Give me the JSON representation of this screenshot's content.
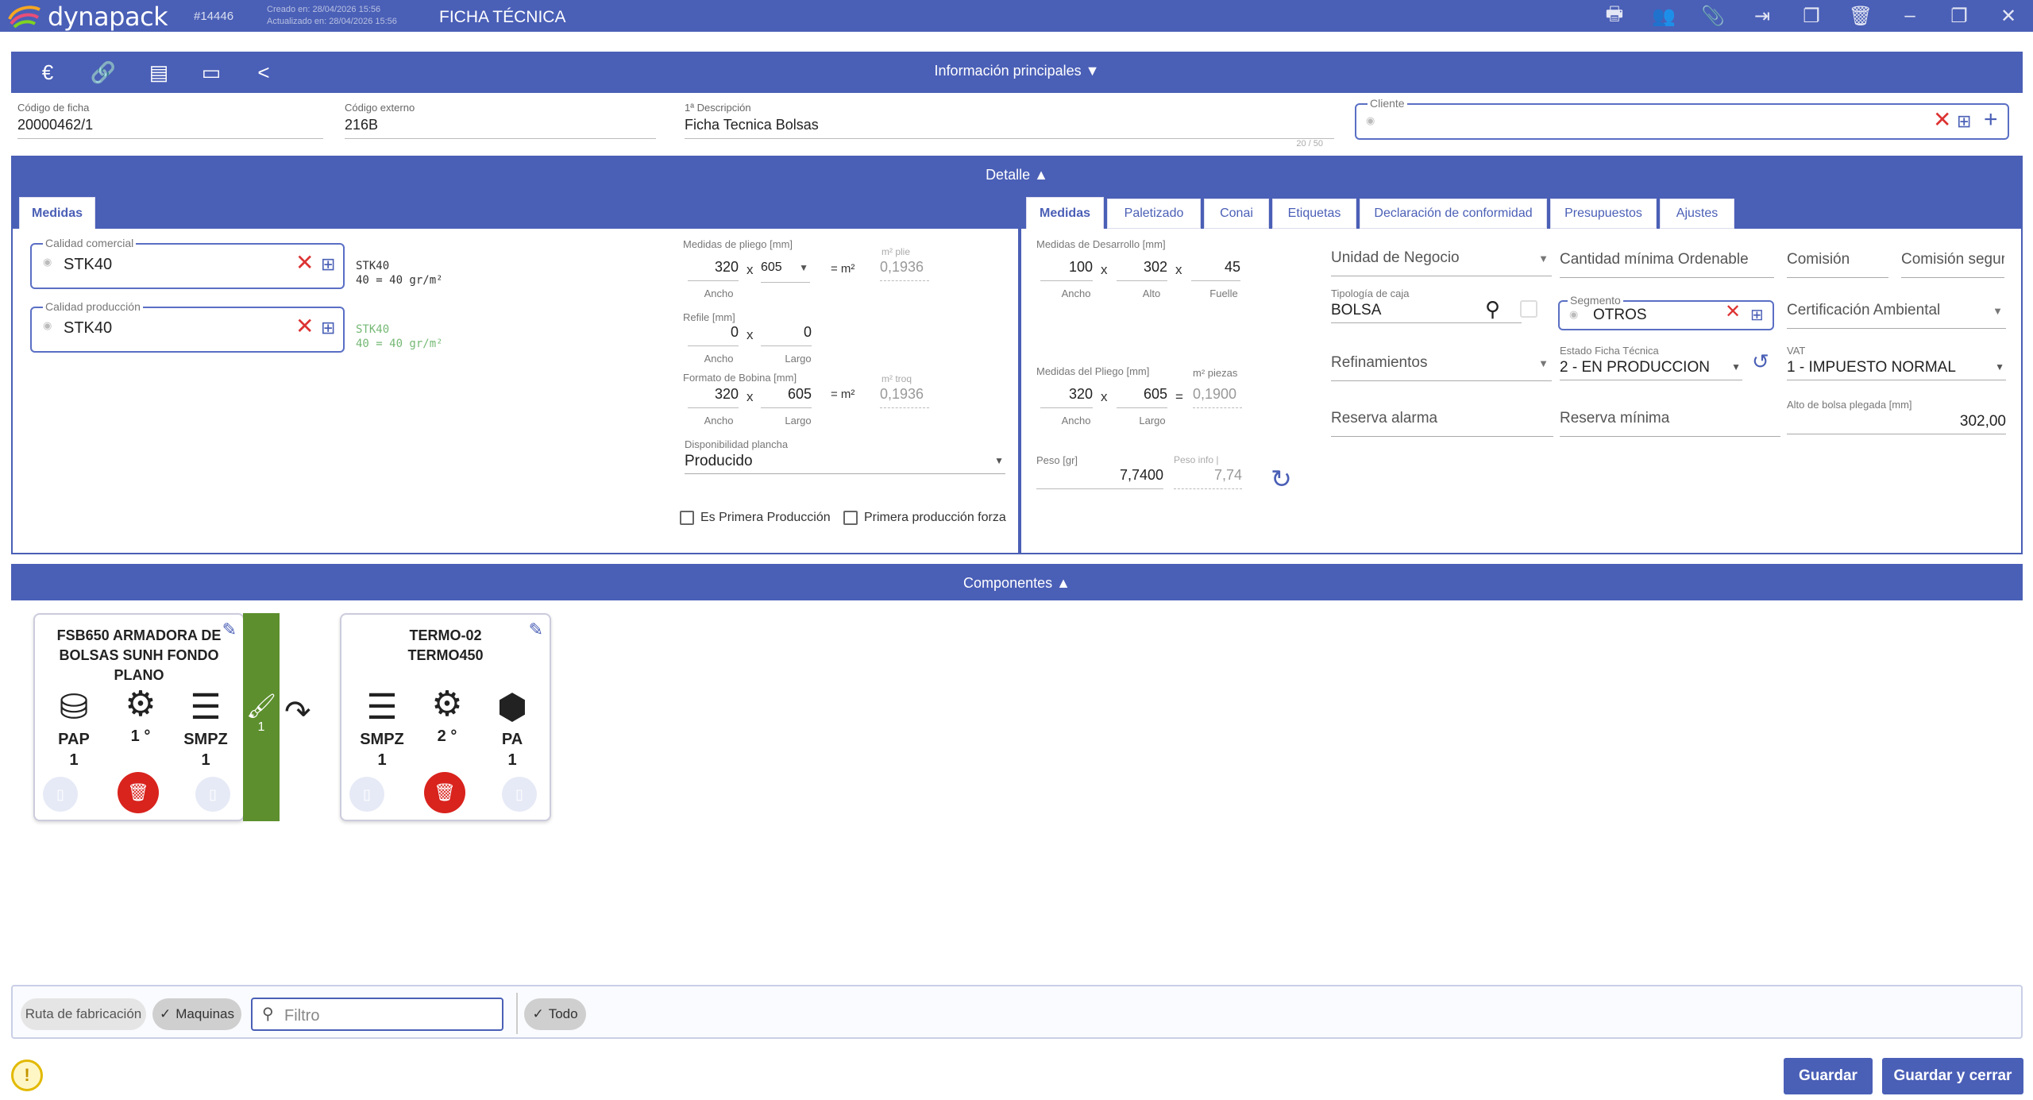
{
  "titlebar": {
    "brand": "dynapack",
    "record": "#14446",
    "created": "Creado en: 28/04/2026 15:56",
    "updated": "Actualizado en: 28/04/2026 15:56",
    "document": "FICHA TÉCNICA"
  },
  "infobar": {
    "title": "Información principales ▼"
  },
  "header_fields": {
    "codigo_ficha": {
      "label": "Código de ficha",
      "value": "20000462/1"
    },
    "codigo_externo": {
      "label": "Código externo",
      "value": "216B"
    },
    "descripcion": {
      "label": "1ª Descripción",
      "value": "Ficha Tecnica Bolsas",
      "counter": "20 / 50"
    },
    "cliente": {
      "label": "Cliente",
      "value": ""
    }
  },
  "detalle": {
    "title": "Detalle ▲",
    "left_tabs": [
      "Medidas"
    ],
    "right_tabs": [
      "Medidas",
      "Paletizado",
      "Conai",
      "Etiquetas",
      "Declaración de conformidad",
      "Presupuestos",
      "Ajustes"
    ]
  },
  "left_panel": {
    "calidad_comercial": {
      "label": "Calidad comercial",
      "value": "STK40",
      "info1": "STK40",
      "info2": "40      = 40 gr/m²"
    },
    "calidad_produccion": {
      "label": "Calidad producción",
      "value": "STK40",
      "info1": "STK40",
      "info2": "40      = 40 gr/m²"
    }
  },
  "pliego": {
    "label": "Medidas de pliego [mm]",
    "ancho": "320",
    "largo": "605",
    "m2_label": "= m²",
    "m2_hint": "m² plie",
    "m2_value": "0,1936",
    "ancho_sub": "Ancho"
  },
  "refile": {
    "label": "Refile [mm]",
    "ancho": "0",
    "largo": "0",
    "ancho_sub": "Ancho",
    "largo_sub": "Largo"
  },
  "bobina": {
    "label": "Formato de Bobina [mm]",
    "ancho": "320",
    "largo": "605",
    "m2_label": "= m²",
    "m2_hint": "m² troq",
    "m2_value": "0,1936",
    "ancho_sub": "Ancho",
    "largo_sub": "Largo"
  },
  "disponibilidad": {
    "label": "Disponibilidad plancha",
    "value": "Producido"
  },
  "checks": {
    "primera": "Es Primera Producción",
    "forzada": "Primera producción forza"
  },
  "desarrollo": {
    "label": "Medidas de Desarrollo [mm]",
    "ancho": "100",
    "alto": "302",
    "fuelle": "45",
    "ancho_sub": "Ancho",
    "alto_sub": "Alto",
    "fuelle_sub": "Fuelle"
  },
  "pliego2": {
    "label": "Medidas del Pliego [mm]",
    "ancho": "320",
    "largo": "605",
    "m2_label": "m² piezas",
    "m2_value": "0,1900",
    "ancho_sub": "Ancho",
    "largo_sub": "Largo"
  },
  "peso": {
    "label": "Peso [gr]",
    "value": "7,7400",
    "info_label": "Peso info |",
    "info_value": "7,74"
  },
  "right_fields": {
    "unidad_negocio": "Unidad de Negocio",
    "cantidad_minima": "Cantidad mínima Ordenable",
    "comision": "Comisión",
    "comision_seguro": "Comisión segur",
    "tipologia_label": "Tipología de caja",
    "tipologia_value": "BOLSA",
    "segmento_label": "Segmento",
    "segmento_value": "OTROS",
    "certificacion": "Certificación Ambiental",
    "refinamientos": "Refinamientos",
    "estado_label": "Estado Ficha Técnica",
    "estado_value": "2 - EN PRODUCCION",
    "vat_label": "VAT",
    "vat_value": "1 - IMPUESTO NORMAL",
    "reserva_alarma": "Reserva alarma",
    "reserva_minima": "Reserva mínima",
    "alto_bolsa_label": "Alto de bolsa plegada [mm]",
    "alto_bolsa_value": "302,00"
  },
  "componentes": {
    "title": "Componentes ▲",
    "cards": [
      {
        "title": "FSB650 ARMADORA DE BOLSAS SUNH FONDO PLANO",
        "icons": [
          {
            "label": "PAP",
            "count": "1"
          },
          {
            "label": "1 °",
            "count": ""
          },
          {
            "label": "SMPZ",
            "count": "1"
          }
        ],
        "strip": "1"
      },
      {
        "title": "TERMO-02 TERMO450",
        "icons": [
          {
            "label": "SMPZ",
            "count": "1"
          },
          {
            "label": "2 °",
            "count": ""
          },
          {
            "label": "PA",
            "count": "1"
          }
        ]
      }
    ]
  },
  "bottom": {
    "ruta": "Ruta de fabricación",
    "maquinas": "Maquinas",
    "filter_placeholder": "Filtro",
    "todo": "Todo"
  },
  "buttons": {
    "guardar": "Guardar",
    "guardar_cerrar": "Guardar y cerrar"
  },
  "colors": {
    "primary": "#4a5fb6",
    "danger": "#d9231d",
    "green": "#5d8f2e"
  }
}
